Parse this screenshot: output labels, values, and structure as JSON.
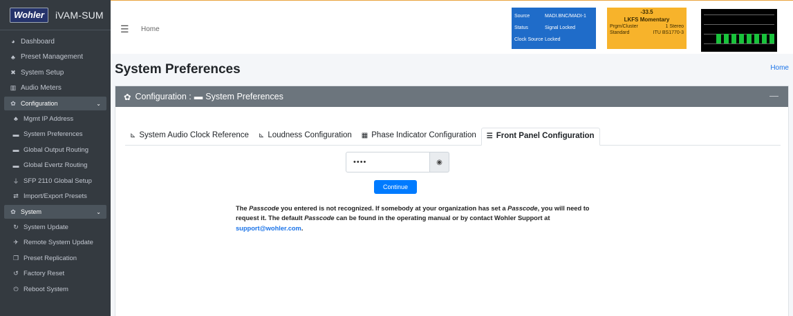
{
  "brand": {
    "logo": "Wohler",
    "product": "iVAM-SUM"
  },
  "sidebar": {
    "items": [
      {
        "icon": "dashboard-icon",
        "glyph": "◕",
        "label": "Dashboard"
      },
      {
        "icon": "preset-management-icon",
        "glyph": "♣",
        "label": "Preset Management"
      },
      {
        "icon": "system-setup-icon",
        "glyph": "✖",
        "label": "System Setup"
      },
      {
        "icon": "audio-meters-icon",
        "glyph": "▥",
        "label": "Audio Meters"
      },
      {
        "icon": "configuration-icon",
        "glyph": "✿",
        "label": "Configuration",
        "active": true,
        "chevron": "⌄"
      },
      {
        "icon": "network-icon",
        "glyph": "♣",
        "label": "Mgmt IP Address",
        "sub": true
      },
      {
        "icon": "keyboard-icon",
        "glyph": "▬",
        "label": "System Preferences",
        "sub": true
      },
      {
        "icon": "keyboard-icon",
        "glyph": "▬",
        "label": "Global Output Routing",
        "sub": true
      },
      {
        "icon": "keyboard-icon",
        "glyph": "▬",
        "label": "Global Evertz Routing",
        "sub": true
      },
      {
        "icon": "usb-icon",
        "glyph": "⏚",
        "label": "SFP 2110 Global Setup",
        "sub": true
      },
      {
        "icon": "exchange-icon",
        "glyph": "⇄",
        "label": "Import/Export Presets",
        "sub": true
      },
      {
        "icon": "cogs-icon",
        "glyph": "✿",
        "label": "System",
        "active": true,
        "chevron": "⌄"
      },
      {
        "icon": "sync-icon",
        "glyph": "↻",
        "label": "System Update",
        "sub": true
      },
      {
        "icon": "satellite-icon",
        "glyph": "✈",
        "label": "Remote System Update",
        "sub": true
      },
      {
        "icon": "clone-icon",
        "glyph": "❐",
        "label": "Preset Replication",
        "sub": true
      },
      {
        "icon": "undo-icon",
        "glyph": "↺",
        "label": "Factory Reset",
        "sub": true
      },
      {
        "icon": "power-icon",
        "glyph": "⏻",
        "label": "Reboot System",
        "sub": true
      }
    ]
  },
  "topbar": {
    "menu_icon": "☰",
    "home": "Home",
    "status_blue": {
      "source_label": "Source",
      "source_value": "MADI.BNC/MADI-1",
      "status_label": "Status",
      "status_value": "Signal Locked",
      "clock_label": "Clock Source",
      "clock_value": "Locked"
    },
    "status_yellow": {
      "level": "-33.5",
      "mode": "LKFS  Momentary",
      "cluster_label": "Prgm/Cluster",
      "cluster_value": "1  Stereo",
      "standard_label": "Standard",
      "standard_value": "ITU BS1770-3"
    },
    "meter_levels": [
      0.48,
      0.48,
      0.48,
      0.48,
      0.48,
      0.48,
      0.48,
      0.48
    ]
  },
  "page": {
    "title": "System Preferences",
    "breadcrumb": "Home",
    "card_header": "Configuration : ",
    "card_header_sub": "System Preferences",
    "collapse": "—"
  },
  "tabs": [
    {
      "icon": "chart-icon",
      "glyph": "⊾",
      "label": "System Audio Clock Reference"
    },
    {
      "icon": "chart-icon",
      "glyph": "⊾",
      "label": "Loudness Configuration"
    },
    {
      "icon": "grid-icon",
      "glyph": "▦",
      "label": "Phase Indicator Configuration"
    },
    {
      "icon": "list-icon",
      "glyph": "☰",
      "label": "Front Panel Configuration",
      "active": true
    }
  ],
  "passcode": {
    "value": "••••",
    "eye": "◉"
  },
  "continue_label": "Continue",
  "message": {
    "part1": "The ",
    "em1": "Passcode",
    "part2": " you entered is not recognized. If somebody at your organization has set a ",
    "em2": "Passcode",
    "part3": ", you will need to request it. The default ",
    "em3": "Passcode",
    "part4": " can be found in the operating manual or by contact Wohler Support at ",
    "link": "support@wohler.com",
    "tail": "."
  },
  "colors": {
    "sidebar": "#343a40",
    "accent_blue": "#1f6cc9",
    "accent_yellow": "#f7b32b",
    "button": "#007bff",
    "meter_green": "#19c23b"
  }
}
